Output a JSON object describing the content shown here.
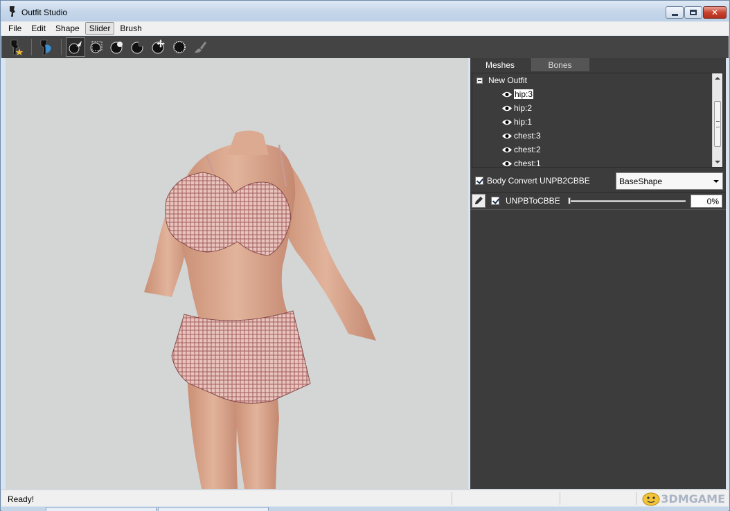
{
  "window": {
    "title": "Outfit Studio"
  },
  "menu": [
    "File",
    "Edit",
    "Shape",
    "Slider",
    "Brush"
  ],
  "toolbar": {
    "buttons": [
      "select-mesh-icon",
      "select-slider-icon",
      "select-brush-icon",
      "mask-brush-icon",
      "inflate-brush-icon",
      "deflate-brush-icon",
      "move-brush-icon",
      "smooth-brush-icon",
      "weight-brush-icon"
    ]
  },
  "panel": {
    "tabs": [
      "Meshes",
      "Bones"
    ],
    "tree": {
      "root": "New Outfit",
      "items": [
        "hip:3",
        "hip:2",
        "hip:1",
        "chest:3",
        "chest:2",
        "chest:1"
      ]
    },
    "project": {
      "label": "Body Convert UNPB2CBBE",
      "shape": "BaseShape"
    },
    "slider": {
      "name": "UNPBToCBBE",
      "value": 0,
      "display": "0%"
    }
  },
  "status": {
    "text": "Ready!"
  },
  "watermark": "3DMGAME",
  "colors": {
    "panel": "#3c3c3c",
    "viewport": "#d3d6d5",
    "toolbar": "#444444"
  }
}
